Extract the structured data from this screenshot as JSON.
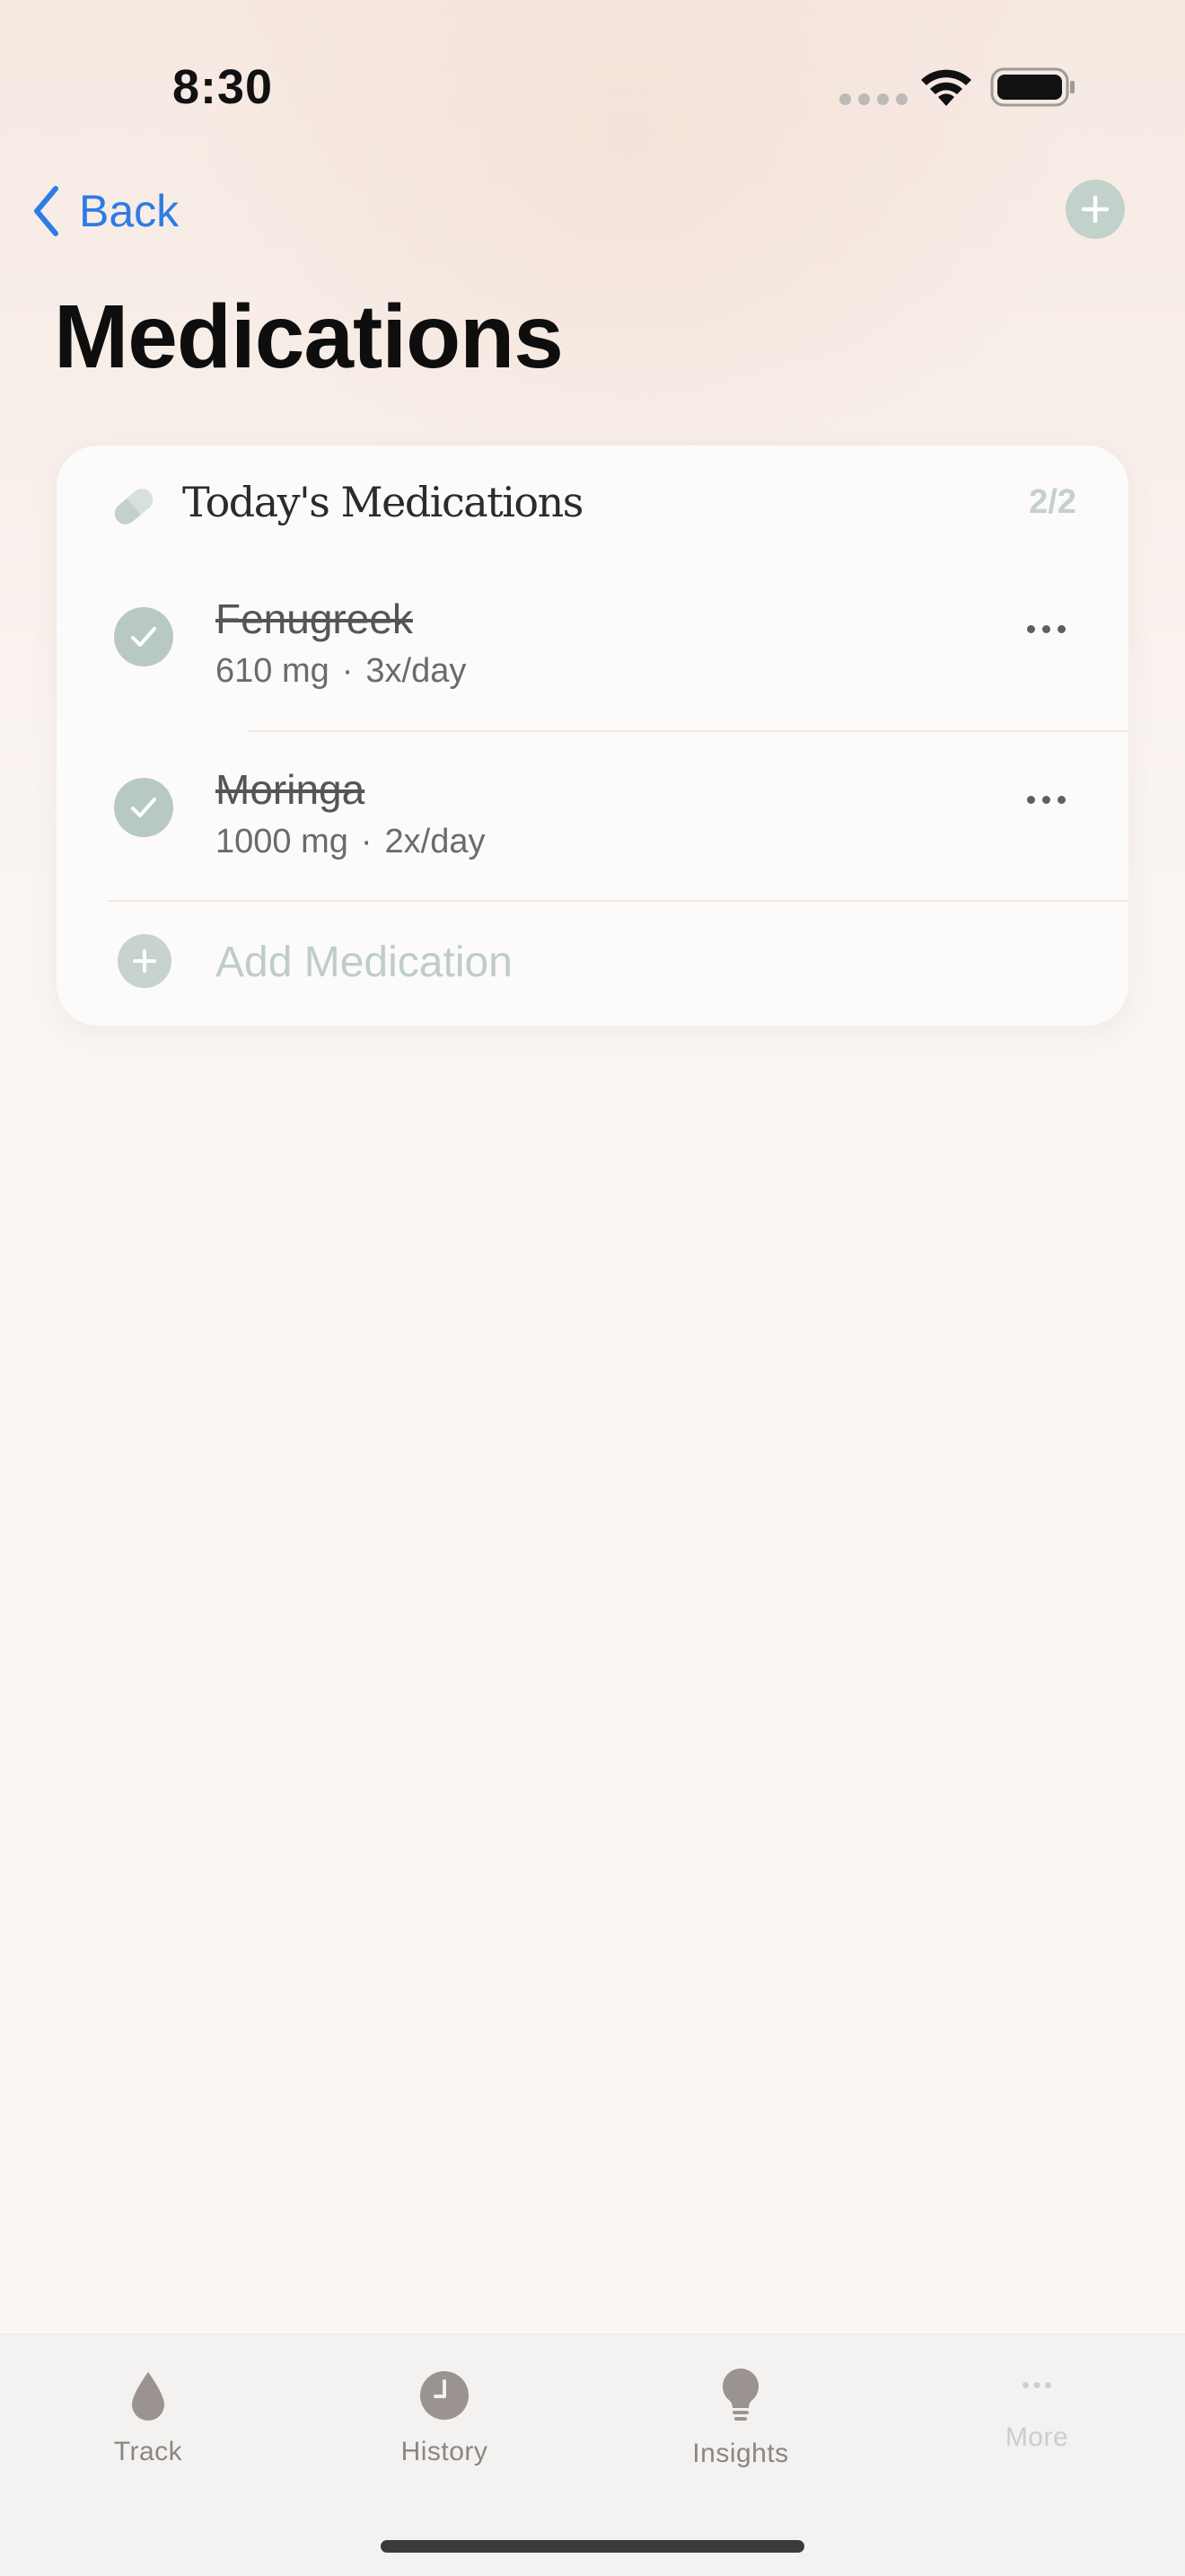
{
  "status_bar": {
    "time": "8:30"
  },
  "nav": {
    "back_label": "Back"
  },
  "page": {
    "title": "Medications"
  },
  "card": {
    "title": "Today's Medications",
    "count": "2/2",
    "medications": [
      {
        "name": "Fenugreek",
        "dose": "610 mg",
        "separator": "·",
        "frequency": "3x/day",
        "taken": true
      },
      {
        "name": "Moringa",
        "dose": "1000 mg",
        "separator": "·",
        "frequency": "2x/day",
        "taken": true
      }
    ],
    "add_label": "Add Medication"
  },
  "tabs": [
    {
      "label": "Track",
      "icon": "drop-icon"
    },
    {
      "label": "History",
      "icon": "clock-icon"
    },
    {
      "label": "Insights",
      "icon": "lightbulb-icon"
    },
    {
      "label": "More",
      "icon": "ellipsis-icon"
    }
  ],
  "colors": {
    "accent_blue": "#2e7be6",
    "sage": "#b8c9c2",
    "tab_icon": "#9a938f"
  }
}
